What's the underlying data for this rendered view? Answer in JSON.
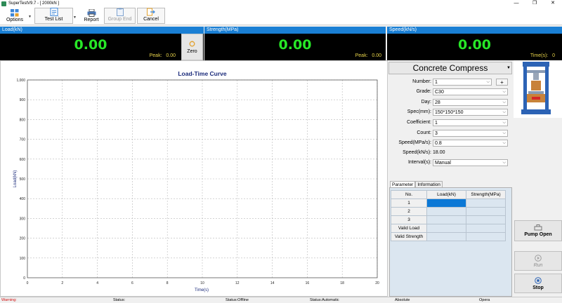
{
  "window": {
    "title": "SuperTestV9.7 - [ 2000kN ]"
  },
  "toolbar": {
    "options": "Options",
    "test_list": "Test List",
    "report": "Report",
    "group_end": "Group End",
    "cancel": "Cancel"
  },
  "readouts": {
    "load": {
      "title": "Load(kN)",
      "value": "0.00",
      "peak_label": "Peak:",
      "peak_value": "0.00"
    },
    "strength": {
      "title": "Strength(MPa)",
      "value": "0.00",
      "peak_label": "Peak:",
      "peak_value": "0.00"
    },
    "speed": {
      "title": "Speed(kN/s)",
      "value": "0.00",
      "time_label": "Time(s):",
      "time_value": "0"
    }
  },
  "zero_label": "Zero",
  "chart_data": {
    "type": "line",
    "title": "Load-Time Curve",
    "xlabel": "Time(s)",
    "ylabel": "Load(kN)",
    "xlim": [
      0,
      20
    ],
    "ylim": [
      0,
      1000
    ],
    "xticks": [
      "0",
      "2",
      "4",
      "6",
      "8",
      "10",
      "12",
      "14",
      "16",
      "18",
      "20"
    ],
    "yticks": [
      "0",
      "100",
      "200",
      "300",
      "400",
      "500",
      "600",
      "700",
      "800",
      "900",
      "1,000"
    ],
    "grid": true,
    "series": []
  },
  "form": {
    "method": "Concrete Compress",
    "number": {
      "label": "Number:",
      "value": "1"
    },
    "grade": {
      "label": "Grade:",
      "value": "C30"
    },
    "day": {
      "label": "Day:",
      "value": "28"
    },
    "spec": {
      "label": "Spec(mm):",
      "value": "150*150*150"
    },
    "coefficient": {
      "label": "Coefficient:",
      "value": "1"
    },
    "count": {
      "label": "Count:",
      "value": "3"
    },
    "speed_mpa": {
      "label": "Speed(MPa/s):",
      "value": "0.8"
    },
    "speed_kn": {
      "label": "Speed(kN/s):",
      "value": "18.00"
    },
    "interval": {
      "label": "Interval(s):",
      "value": "Manual"
    }
  },
  "tabs": {
    "parameter": "Parameter",
    "information": "Information"
  },
  "result_table": {
    "headers": [
      "No.",
      "Load(kN)",
      "Strength(MPa)"
    ],
    "rows": [
      "1",
      "2",
      "3",
      "Valid Load",
      "Valid Strength"
    ]
  },
  "side": {
    "pump_open": "Pump Open",
    "run": "Run",
    "stop": "Stop"
  },
  "status": {
    "warning": "Warning:",
    "status": "Status:",
    "offline": "Status:Offline",
    "automatic": "Status:Automatic",
    "absolute": "Absolute",
    "opera": "Opera"
  },
  "colors": {
    "header_blue": "#1a7fd4",
    "readout_green": "#27e827",
    "peak_yellow": "#e8d44a",
    "selected_cell": "#0b78d6"
  }
}
